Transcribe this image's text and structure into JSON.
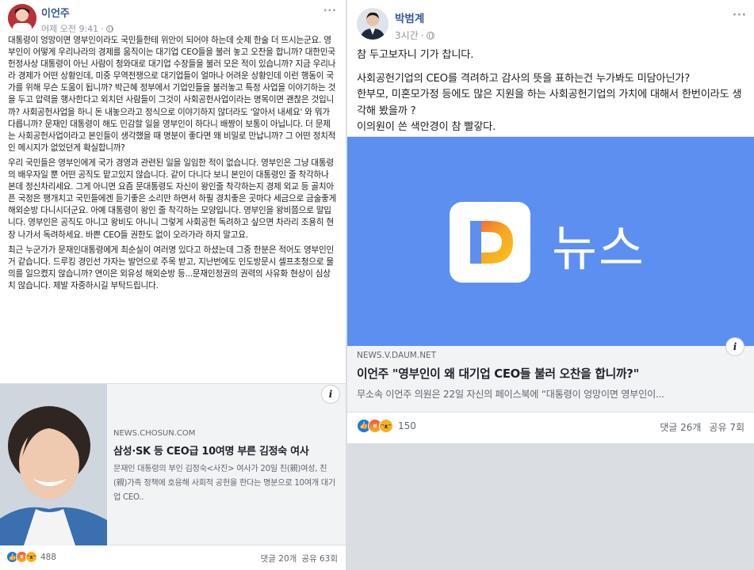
{
  "left_post": {
    "author": "이언주",
    "time": "어제 오전 9:41",
    "dots": "···",
    "paragraphs": [
      "대통령이 엉망이면 영부인이라도 국민들한테 위안이 되어야 하는데 숫제 한술 더 뜨시는군요. 영부인이 어떻게 우리나라의 경제를 움직이는 대기업 CEO들을 불러 놓고 오찬을 합니까? 대한민국 헌정사상 대통령이 아닌 사람이 청와대로 대기업 수장들을 불러 모은 적이 있습니까? 지금 우리나라 경제가 어떤 상황인데, 미중 무역전쟁으로 대기업들이 얼마나 어려운 상황인데 이런 행동이 국가를 위해 무슨 도움이 됩니까? 박근혜 정부에서 기업인들을 불러놓고 특정 사업을 이야기하는 것을 두고 압력을 행사한다고 외치던 사람들이 그것이 사회공헌사업이라는 명목이면 괜찮은 것입니까? 사회공헌사업을 하니 돈 내놓으라고 정식으로 이야기하지 않더라도 '알아서 내세요' 와 뭐가 다릅니까? 문재인 대통령이 해도 민감할 일을 영부인이 하다니 배짱이 보통이 아닙니다. 더 문제는 사회공헌사업이라고 본인들이 생각했을 때 명분이 좋다면 왜 비밀로 만납니까? 그 어떤 정치적인 메시지가 없었던게 확실합니까?",
      "우리 국민들은 영부인에게 국가 경영과 관련된 일을 일임한 적이 없습니다. 영부인은 그냥 대통령의 배우자일 뿐 어떤 공직도 맡고있지 않습니다. 같이 다니다 보니 본인이 대통령인 줄 착각하나 본데 정신차리세요. 그게 아니면 요즘 문대통령도 자신이 왕인줄 착각하는지 경제 외교 등 골치아픈 국정은 팽개치고 국민들에겐 듣기좋은 소리만 하면서 하필 경치좋은 곳마다 세금으로 금술좋게 해외순방 다니시더군요. 아예 대통령이 왕인 줄 착각하는 모양입니다. 영부인을 왕비쯤으로 말입니다. 영부인은 공직도 아니고 왕비도 아니니 그렇게 사회공헌 독려하고 싶으면 차라리 조용히 현장 나가서 독려하세요. 바쁜 CEO들 권한도 없이 오라가라 하지 말고요.",
      "최근 누군가가 문재인대통령에게 최순실이 여러명 있다고 하셨는데 그중 한분은 적어도 영부인인거 같습니다. 드루킹 경인선 가자는 발언으로 주목 받고, 지난번에도 인도방문시 셀프초청으로 물의를 일으켰지 않습니까? 연이은 외유성 해외순방 등...문재인정권의 권력의 사유화 현상이 심상치 않습니다. 제발 자중하시길 부탁드립니다."
    ],
    "link": {
      "domain": "NEWS.CHOSUN.COM",
      "title": "삼성·SK 등 CEO급 10여명 부른 김정숙 여사",
      "desc": "문재인 대통령의 부인 김정숙<사진> 여사가 20일 친(親)여성, 친(親)가족 정책에 호응해 사회적 공헌을 한다는 명분으로 10여개 대기업 CEO..",
      "info": "i"
    },
    "reaction_count": "488",
    "comments": "댓글 20개",
    "shares": "공유 63회"
  },
  "right_post": {
    "author": "박범계",
    "time": "3시간",
    "dots": "···",
    "line1": "참 두고보자니 기가 찹니다.",
    "line2": "사회공헌기업의 CEO를 격려하고 감사의 뜻을 표하는건 누가봐도 미담아닌가?\n한부모, 미혼모가정 등에도 많은 지원을 하는 사회공헌기업의 가치에 대해서 한번이라도 생각해 봤을까 ?\n이의원이 쓴 색안경이 참 빨갛다.",
    "banner_text": "뉴스",
    "logo_letter": "D",
    "link": {
      "domain": "NEWS.V.DAUM.NET",
      "title": "이언주 \"영부인이 왜 대기업 CEO들 불러 오찬을 합니까?\"",
      "desc": "무소속 이언주 의원은 22일 자신의 페이스북에 “대통령이 엉망이면 영부인이...",
      "info": "i"
    },
    "reaction_count": "150",
    "comments": "댓글 26개",
    "shares": "공유 7회"
  },
  "colors": {
    "link_name": "#385898",
    "daum_blue": "#5c8ff0",
    "like_blue": "#1877f2"
  },
  "icons": [
    "globe-icon",
    "like-reaction-icon",
    "angry-reaction-icon",
    "haha-reaction-icon",
    "info-icon"
  ]
}
